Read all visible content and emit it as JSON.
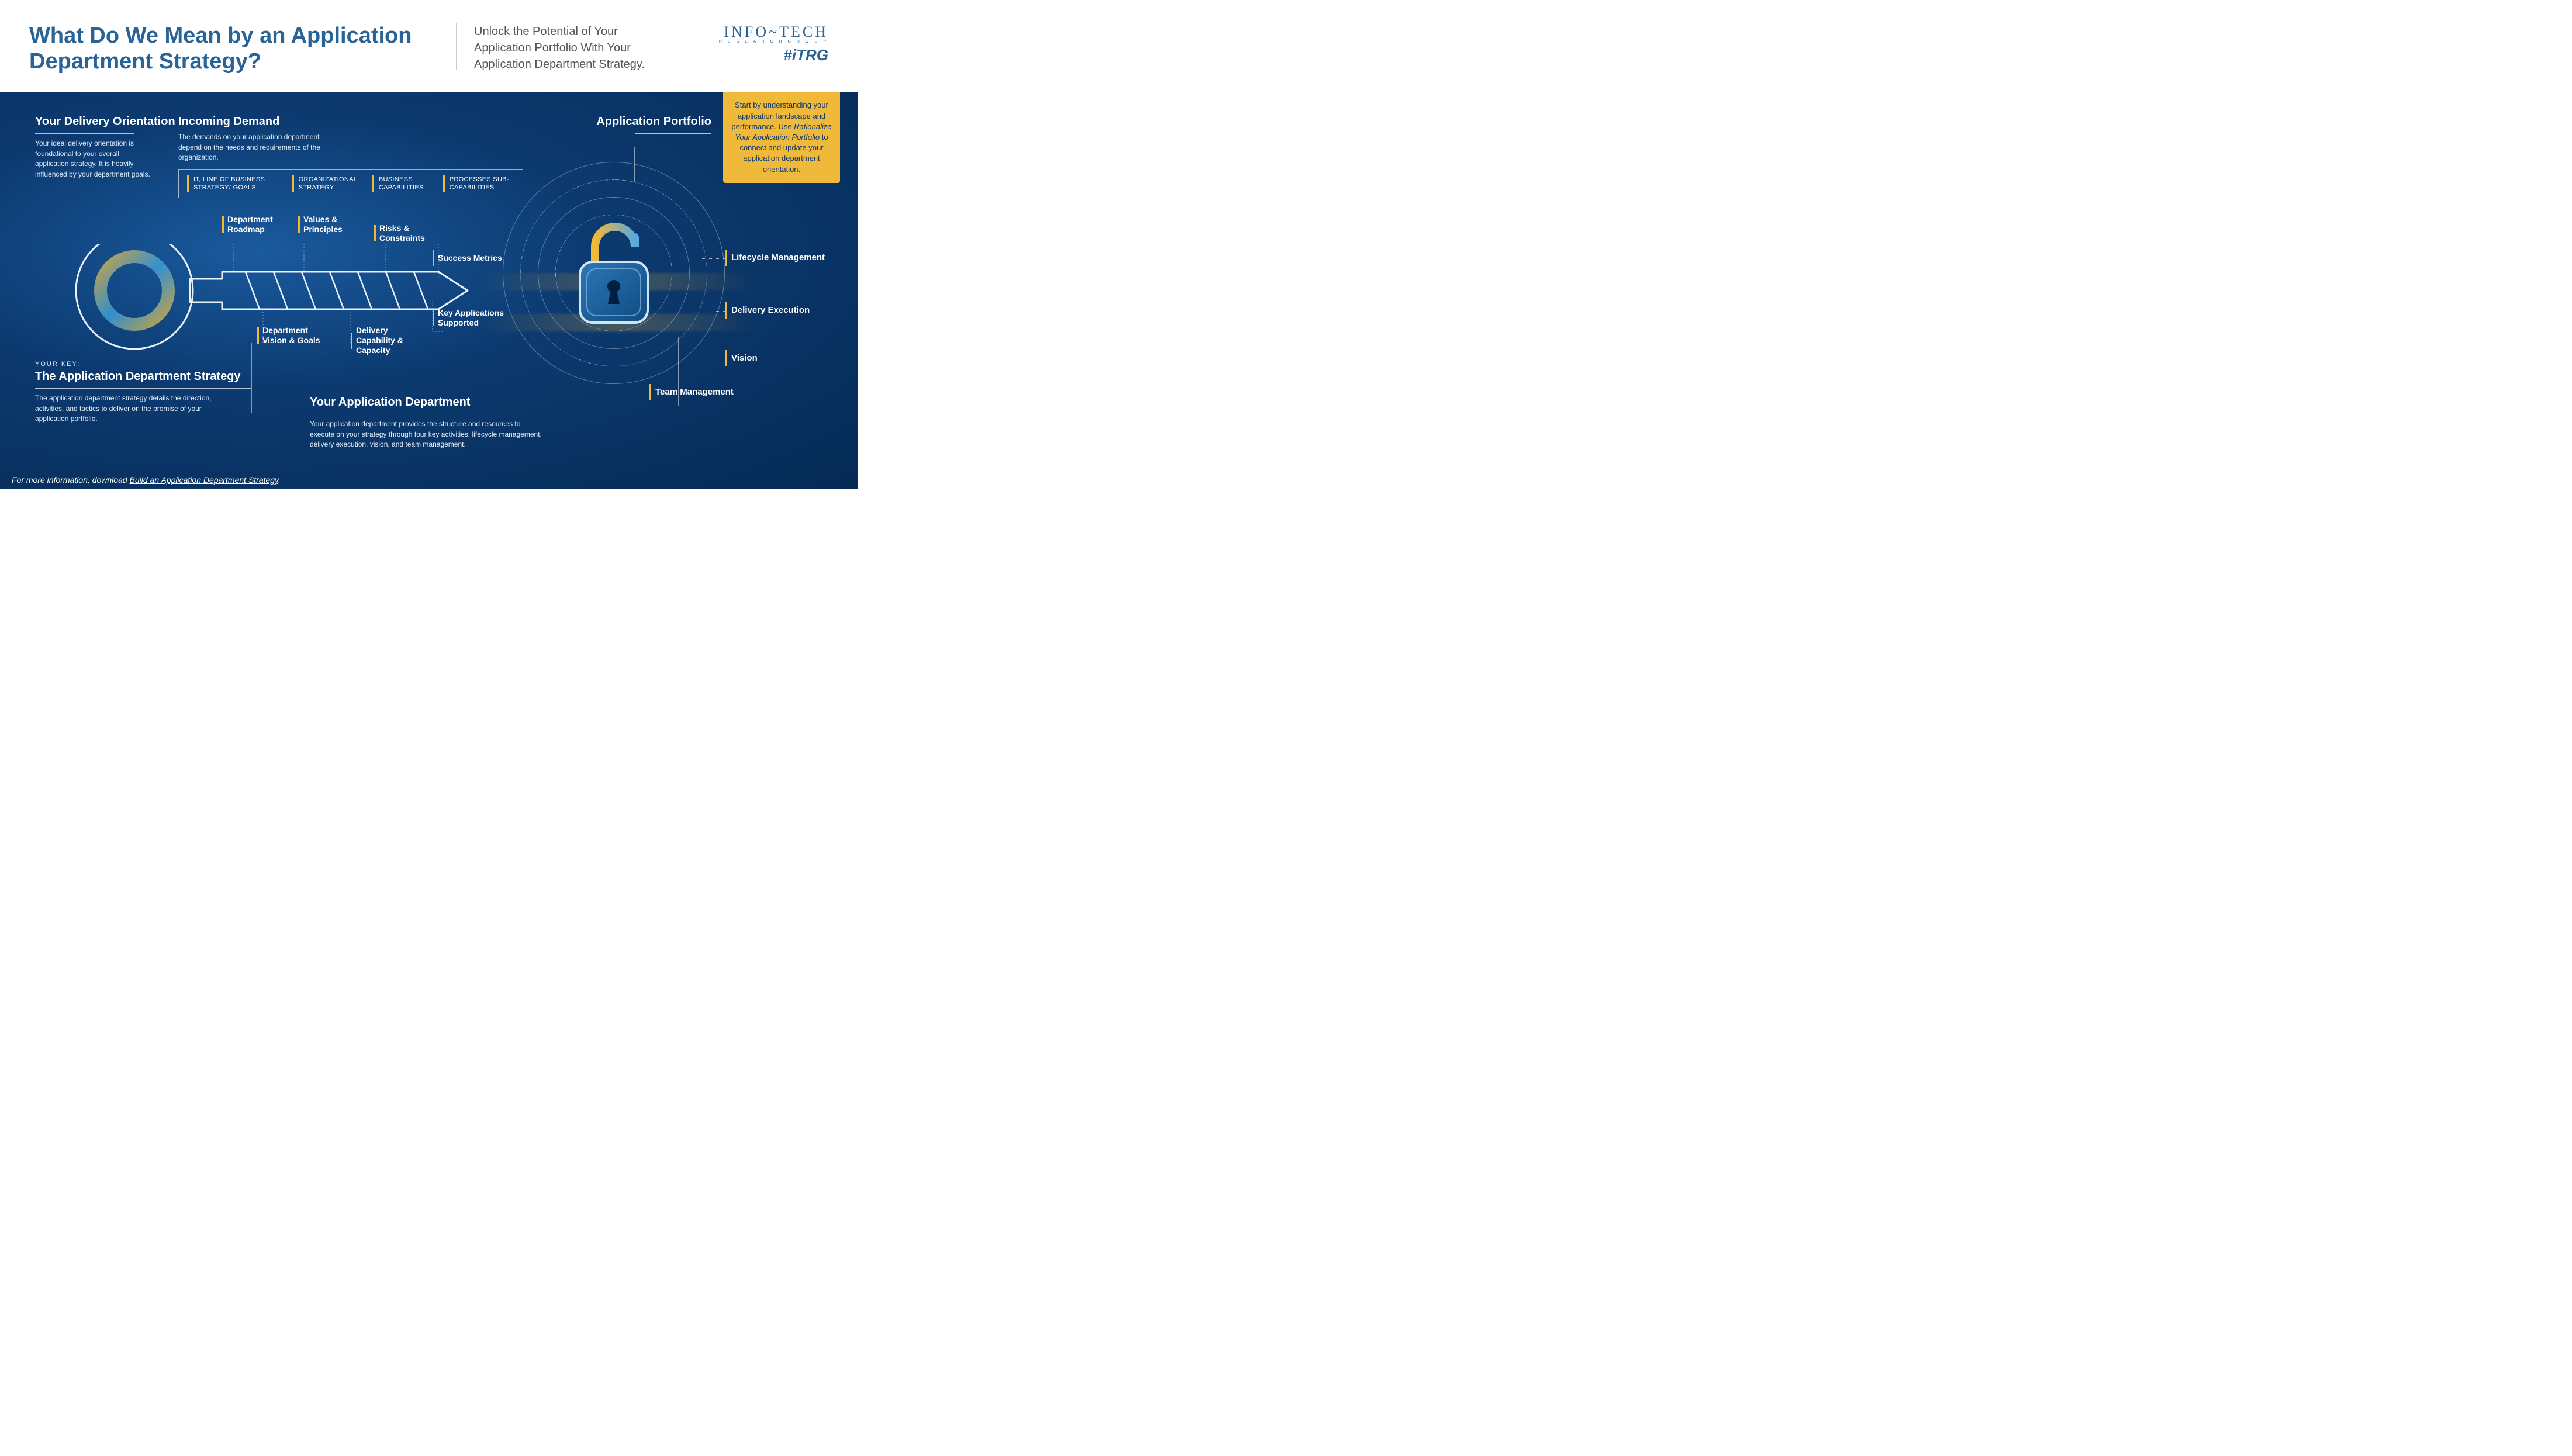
{
  "header": {
    "title": "What Do We Mean by an Application Department Strategy?",
    "subtitle": "Unlock the Potential of Your Application Portfolio With Your Application Department Strategy.",
    "brand_main": "INFO~TECH",
    "brand_sub": "R E S E A R C H   G R O U P",
    "brand_tag": "#iTRG"
  },
  "callout": {
    "line1": "Start by understanding your application landscape and performance. Use ",
    "emph": "Rationalize Your Application Portfolio",
    "line2": " to connect and update your application department orientation."
  },
  "delivery": {
    "heading": "Your Delivery Orientation",
    "body": "Your ideal delivery orientation is foundational to your overall application strategy. It is heavily influenced by your department goals."
  },
  "incoming": {
    "heading": "Incoming Demand",
    "sub": "The demands on your application department depend on the needs and requirements of the organization.",
    "items": [
      "IT, LINE OF BUSINESS STRATEGY/ GOALS",
      "ORGANIZATIONAL STRATEGY",
      "BUSINESS CAPABILITIES",
      "PROCESSES SUB-CAPABILITIES"
    ]
  },
  "portfolio": {
    "heading": "Application Portfolio"
  },
  "yourkey": {
    "kicker": "YOUR KEY:",
    "heading": "The Application Department Strategy",
    "body": "The application department strategy details the direction, activities, and tactics to deliver on the promise of your application portfolio."
  },
  "yourdept": {
    "heading": "Your Application Department",
    "body": "Your application department provides the structure and resources to execute on your strategy through four key activities: lifecycle management, delivery execution, vision, and team management."
  },
  "key_labels_top": [
    "Department Roadmap",
    "Values & Principles",
    "Risks & Constraints",
    "Success Metrics"
  ],
  "key_labels_bottom": [
    "Department Vision & Goals",
    "Delivery Capability & Capacity",
    "Key Applications Supported"
  ],
  "right_labels": [
    "Lifecycle Management",
    "Delivery Execution",
    "Vision",
    "Team Management"
  ],
  "footer": {
    "prefix": "For more information, download ",
    "link": "Build an Application Department Strategy",
    "suffix": "."
  }
}
